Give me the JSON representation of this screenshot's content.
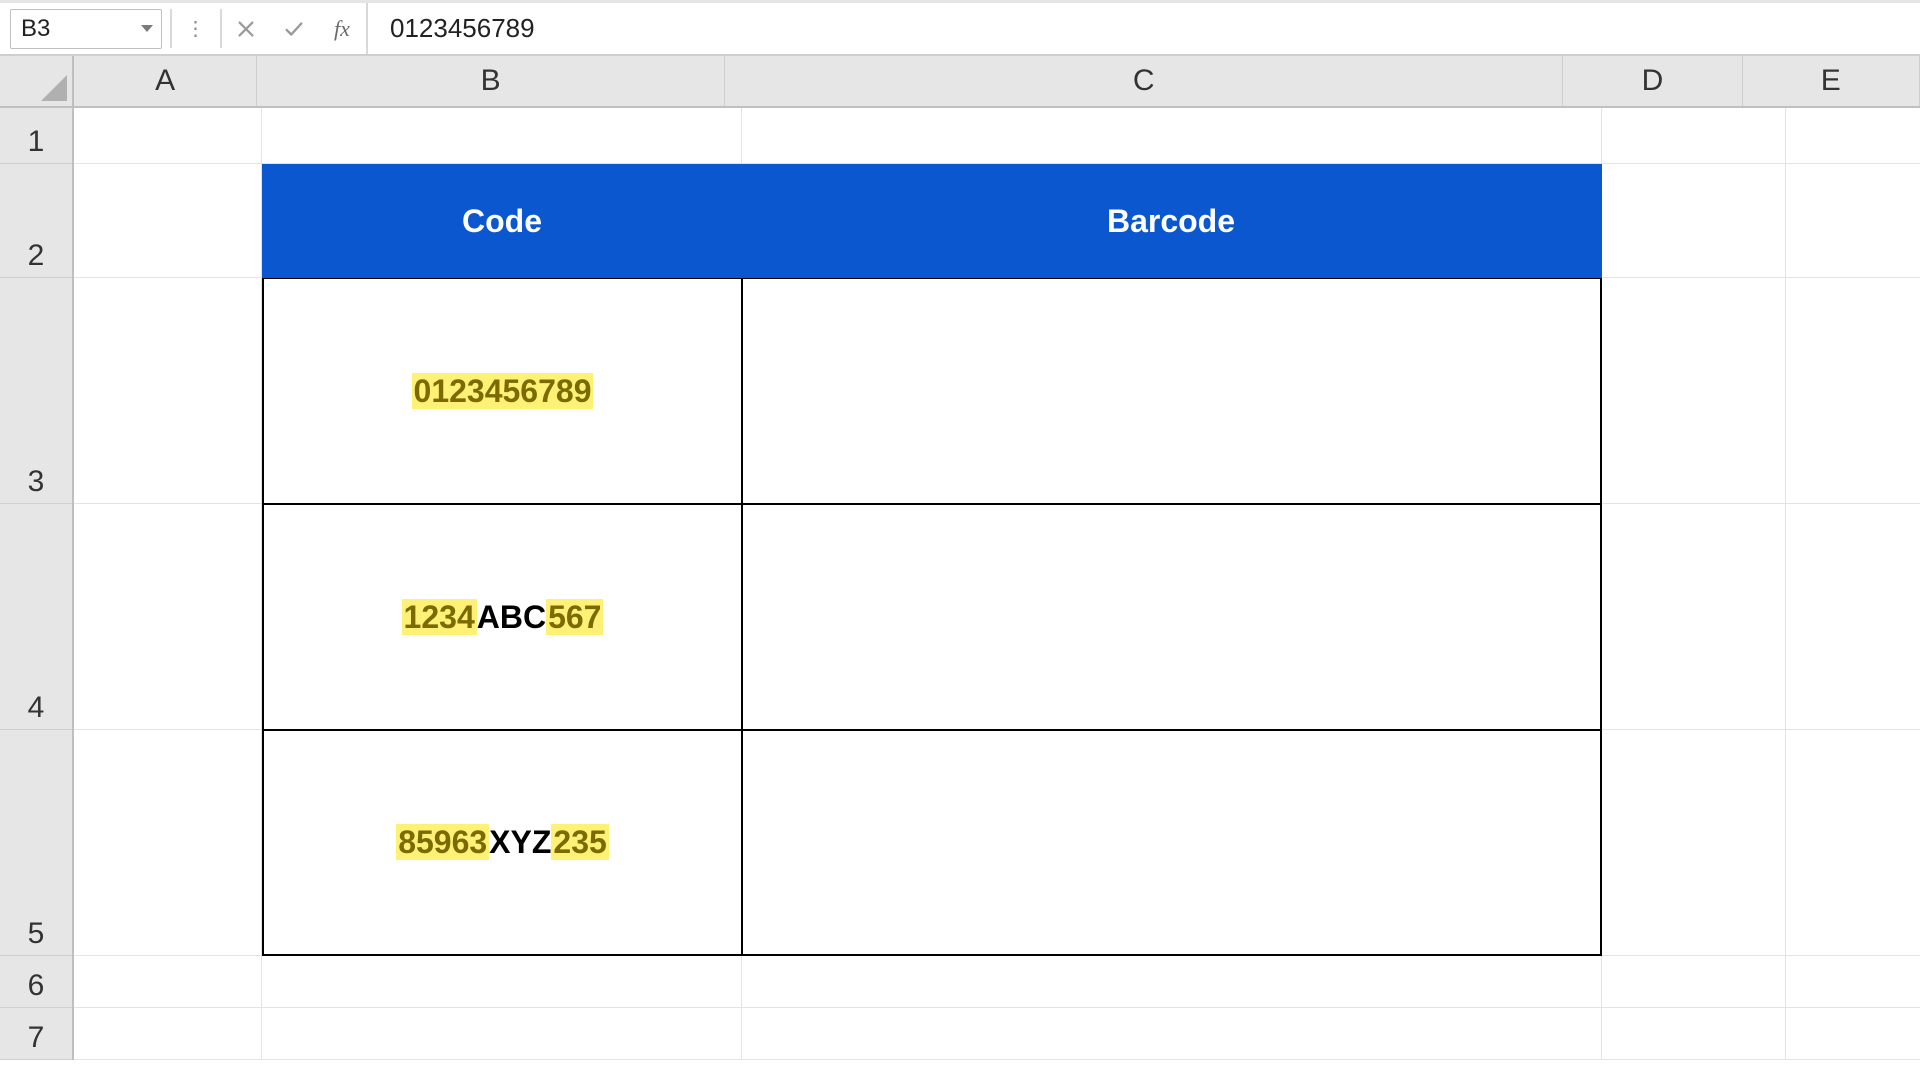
{
  "formula_bar": {
    "name_box": "B3",
    "fx_label": "fx",
    "formula_value": "0123456789"
  },
  "columns": {
    "A": "A",
    "B": "B",
    "C": "C",
    "D": "D",
    "E": "E"
  },
  "rows": {
    "r1": "1",
    "r2": "2",
    "r3": "3",
    "r4": "4",
    "r5": "5",
    "r6": "6",
    "r7": "7"
  },
  "table": {
    "headers": {
      "code": "Code",
      "barcode": "Barcode"
    },
    "rows": [
      {
        "code_segments": [
          {
            "t": "0123456789",
            "num": true
          }
        ],
        "barcode": ""
      },
      {
        "code_segments": [
          {
            "t": "1234",
            "num": true
          },
          {
            "t": "ABC",
            "num": false
          },
          {
            "t": "567",
            "num": true
          }
        ],
        "barcode": ""
      },
      {
        "code_segments": [
          {
            "t": "85963",
            "num": true
          },
          {
            "t": "XYZ",
            "num": false
          },
          {
            "t": "235",
            "num": true
          }
        ],
        "barcode": ""
      }
    ]
  },
  "colors": {
    "header_bg": "#0b57d0",
    "highlight_bg": "#fff176",
    "highlight_fg": "#7a6a00"
  }
}
